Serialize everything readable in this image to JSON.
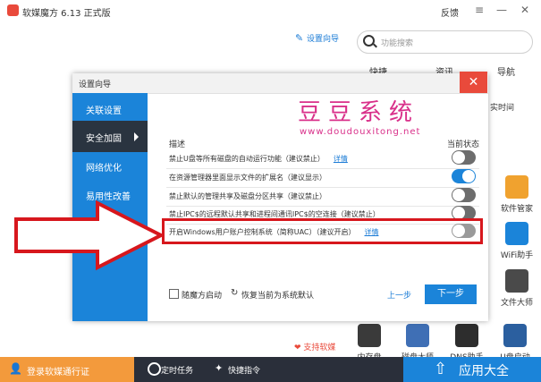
{
  "app": {
    "title": "软媒魔方 6.13 正式版",
    "feedback": "反馈"
  },
  "window": {
    "menu_icon": "≡",
    "minimize_icon": "—",
    "close_icon": "✕"
  },
  "toolbar": {
    "setup_wizard": "设置向导",
    "search_placeholder": "功能搜索"
  },
  "top_tabs": [
    "快捷",
    "资讯",
    "导航"
  ],
  "right_panel": {
    "clock_label": "实时间"
  },
  "tools": [
    {
      "label": "软件管家",
      "color": "#f0a22f"
    },
    {
      "label": "WiFi助手",
      "color": "#1b84d9"
    },
    {
      "label": "文件大师",
      "color": "#4a4a4a"
    },
    {
      "label": "内存盘",
      "color": "#3a3a3a"
    },
    {
      "label": "磁盘大师",
      "color": "#3f6fb5"
    },
    {
      "label": "DNS助手",
      "color": "#2d2d2d"
    },
    {
      "label": "U盘启动",
      "color": "#2b5f9f"
    }
  ],
  "support": "支持软媒",
  "dialog": {
    "title": "设置向导",
    "close": "✕",
    "sidebar": [
      {
        "label": "关联设置"
      },
      {
        "label": "安全加固"
      },
      {
        "label": "网络优化"
      },
      {
        "label": "易用性改善"
      }
    ],
    "watermark_title": "豆豆系统",
    "watermark_url": "www.doudouxitong.net",
    "col_desc": "描述",
    "col_state": "当前状态",
    "rows": [
      {
        "text": "禁止U盘等所有磁盘的自动运行功能（建议禁止）",
        "link": "详情",
        "on": false
      },
      {
        "text": "在资源管理器里面显示文件的扩展名（建议显示）",
        "link": "",
        "on": true
      },
      {
        "text": "禁止默认的管理共享及磁盘分区共享（建议禁止）",
        "link": "",
        "on": false
      },
      {
        "text": "禁止IPC$的远程默认共享和进程间通讯IPC$的空连接（建议禁止）",
        "link": "",
        "on": false
      },
      {
        "text": "开启Windows用户账户控制系统（简称UAC）（建议开启）",
        "link": "详情",
        "on": false
      }
    ],
    "autostart_label": "随魔方启动",
    "restore_label": "恢复当前为系统默认",
    "prev": "上一步",
    "next": "下一步"
  },
  "bottom": {
    "login": "登录软媒通行证",
    "timed_tasks": "定时任务",
    "quick_commands": "快捷指令",
    "app_store": "应用大全"
  }
}
